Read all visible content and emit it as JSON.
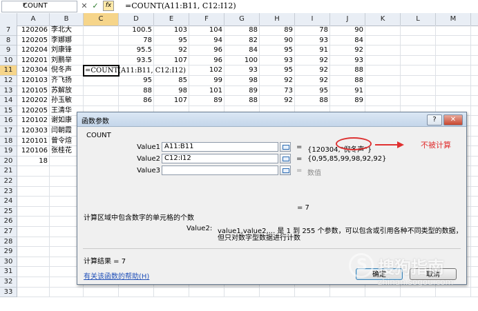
{
  "formula_bar": {
    "name_box": "COUNT",
    "cancel_symbol": "✕",
    "enter_symbol": "✓",
    "fx_symbol": "fx",
    "formula": "=COUNT(A11:B11, C12:I12)"
  },
  "columns": [
    "A",
    "B",
    "C",
    "D",
    "E",
    "F",
    "G",
    "H",
    "I",
    "J",
    "K",
    "L",
    "M"
  ],
  "selected_column": "C",
  "selected_row": "11",
  "rows": [
    {
      "r": "7",
      "A": "120206",
      "B": "李北大",
      "D": "100.5",
      "E": "103",
      "F": "104",
      "G": "88",
      "H": "89",
      "I": "78",
      "J": "90"
    },
    {
      "r": "8",
      "A": "120205",
      "B": "李娜娜",
      "D": "78",
      "E": "95",
      "F": "94",
      "G": "82",
      "H": "90",
      "I": "93",
      "J": "84"
    },
    {
      "r": "9",
      "A": "120204",
      "B": "刘康锋",
      "D": "95.5",
      "E": "92",
      "F": "96",
      "G": "84",
      "H": "95",
      "I": "91",
      "J": "92"
    },
    {
      "r": "10",
      "A": "120201",
      "B": "刘鹏举",
      "D": "93.5",
      "E": "107",
      "F": "96",
      "G": "100",
      "H": "93",
      "I": "92",
      "J": "93"
    },
    {
      "r": "11",
      "A": "120304",
      "B": "倪冬声",
      "C": "=COUNT(A11:B11, C12:I12)",
      "F": "102",
      "G": "93",
      "H": "95",
      "I": "92",
      "J": "88"
    },
    {
      "r": "12",
      "A": "120103",
      "B": "齐飞扬",
      "D": "95",
      "E": "85",
      "F": "99",
      "G": "98",
      "H": "92",
      "I": "92",
      "J": "88"
    },
    {
      "r": "13",
      "A": "120105",
      "B": "苏解放",
      "D": "88",
      "E": "98",
      "F": "101",
      "G": "89",
      "H": "73",
      "I": "95",
      "J": "91"
    },
    {
      "r": "14",
      "A": "120202",
      "B": "孙玉敏",
      "D": "86",
      "E": "107",
      "F": "89",
      "G": "88",
      "H": "92",
      "I": "88",
      "J": "89"
    },
    {
      "r": "15",
      "A": "120205",
      "B": "王清华"
    },
    {
      "r": "16",
      "A": "120102",
      "B": "谢如康"
    },
    {
      "r": "17",
      "A": "120303",
      "B": "闫朝霞"
    },
    {
      "r": "18",
      "A": "120101",
      "B": "曾令煊"
    },
    {
      "r": "19",
      "A": "120106",
      "B": "张桂花"
    },
    {
      "r": "20",
      "A": "18"
    },
    {
      "r": "21"
    },
    {
      "r": "22"
    },
    {
      "r": "23"
    },
    {
      "r": "24"
    },
    {
      "r": "25"
    },
    {
      "r": "26"
    },
    {
      "r": "27"
    },
    {
      "r": "28"
    },
    {
      "r": "29"
    },
    {
      "r": "30"
    },
    {
      "r": "31"
    },
    {
      "r": "32"
    },
    {
      "r": "33"
    }
  ],
  "dialog": {
    "title": "函数参数",
    "help_symbol": "?",
    "close_symbol": "✕",
    "function_name": "COUNT",
    "args": [
      {
        "label": "Value1",
        "value": "A11:B11",
        "result": "{120304,\"倪冬声\"}"
      },
      {
        "label": "Value2",
        "value": "C12:I12",
        "result": "{0,95,85,99,98,92,92}"
      },
      {
        "label": "Value3",
        "value": "",
        "result": "数值"
      }
    ],
    "eq": "=",
    "annotation": "不被计算",
    "formula_result_line": "= 7",
    "description": "计算区域中包含数字的单元格的个数",
    "arg_desc_name": "Value2:",
    "arg_desc_line1": "value1,value2,... 是 1 到 255 个参数，可以包含或引用各种不同类型的数据，",
    "arg_desc_line2": "但只对数字型数据进行计数",
    "calc_result": "计算结果 =  7",
    "help_link": "有关该函数的帮助(H)",
    "ok": "确定",
    "cancel": "取消"
  },
  "watermark": {
    "text": "搜狗指南",
    "url": "zhinan.sogou.com"
  }
}
